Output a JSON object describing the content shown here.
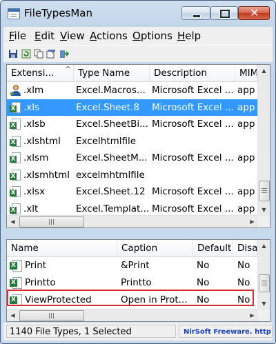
{
  "window": {
    "title": "FileTypesMan"
  },
  "menubar": [
    {
      "key": "F",
      "rest": "ile"
    },
    {
      "key": "E",
      "rest": "dit"
    },
    {
      "key": "V",
      "rest": "iew"
    },
    {
      "key": "A",
      "rest": "ctions"
    },
    {
      "key": "O",
      "rest": "ptions"
    },
    {
      "key": "H",
      "rest": "elp"
    }
  ],
  "toolbar_icons": [
    "save-icon",
    "refresh-icon",
    "copy-icon",
    "properties-icon",
    "exit-icon"
  ],
  "file_types": {
    "columns": [
      "Extensi...",
      "Type Name",
      "Description",
      "MIM"
    ],
    "rows": [
      {
        "icon": "user-icon",
        "ext": ".xlm",
        "type": "Excel.Macros...",
        "desc": "Microsoft Excel ...",
        "mime": "app",
        "selected": false
      },
      {
        "icon": "excel-icon",
        "ext": ".xls",
        "type": "Excel.Sheet.8",
        "desc": "Microsoft Excel ...",
        "mime": "app",
        "selected": true
      },
      {
        "icon": "excel-icon",
        "ext": ".xlsb",
        "type": "Excel.SheetBi...",
        "desc": "Microsoft Excel ...",
        "mime": "app",
        "selected": false
      },
      {
        "icon": "excel-icon",
        "ext": ".xlshtml",
        "type": "Excelhtmlfile",
        "desc": "",
        "mime": "",
        "selected": false
      },
      {
        "icon": "excel-icon",
        "ext": ".xlsm",
        "type": "Excel.SheetM...",
        "desc": "Microsoft Excel ...",
        "mime": "app",
        "selected": false
      },
      {
        "icon": "excel-icon",
        "ext": ".xlsmhtml",
        "type": "excelmhtmlfile",
        "desc": "",
        "mime": "",
        "selected": false
      },
      {
        "icon": "excel-icon",
        "ext": ".xlsx",
        "type": "Excel.Sheet.12",
        "desc": "Microsoft Excel ...",
        "mime": "app",
        "selected": false
      },
      {
        "icon": "excel-icon",
        "ext": ".xlt",
        "type": "Excel.Templat...",
        "desc": "Microsoft Excel ...",
        "mime": "app",
        "selected": false
      }
    ]
  },
  "actions": {
    "columns": [
      "Name",
      "Caption",
      "Default",
      "Disa"
    ],
    "rows": [
      {
        "name": "Print",
        "caption": "&Print",
        "default": "No",
        "disabled": "No"
      },
      {
        "name": "Printto",
        "caption": "Printto",
        "default": "No",
        "disabled": "No"
      },
      {
        "name": "ViewProtected",
        "caption": "Open in Prot...",
        "default": "No",
        "disabled": "No"
      }
    ]
  },
  "status": {
    "count_text": "1140 File Types, 1 Selected",
    "link_text": "NirSoft Freeware.  http://w"
  },
  "colors": {
    "selection": "#3399ff",
    "highlight_box": "#d92b2b",
    "excel_green": "#2a7a3d",
    "link": "#1a3fc2"
  }
}
